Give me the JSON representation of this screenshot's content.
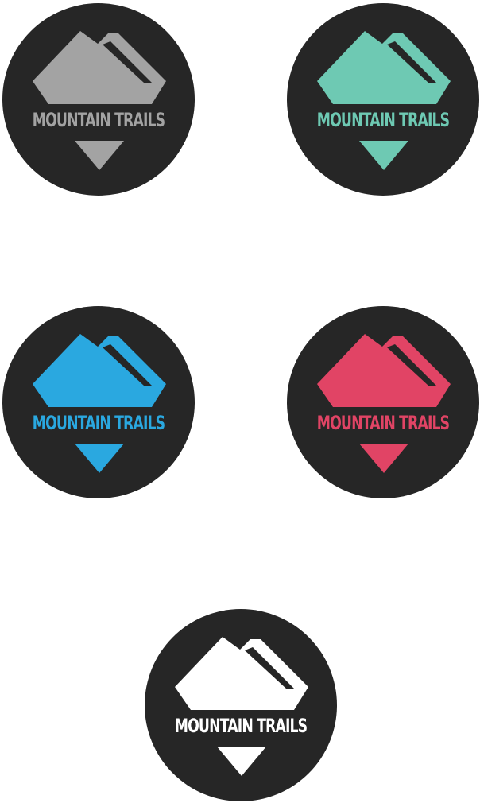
{
  "badges": [
    {
      "text": "MOUNTAIN TRAILS",
      "color": "#a3a3a3"
    },
    {
      "text": "MOUNTAIN TRAILS",
      "color": "#6ec9b3"
    },
    {
      "text": "MOUNTAIN TRAILS",
      "color": "#2aa8e0"
    },
    {
      "text": "MOUNTAIN TRAILS",
      "color": "#e14465"
    },
    {
      "text": "MOUNTAIN TRAILS",
      "color": "#ffffff"
    }
  ],
  "background_color": "#262626"
}
